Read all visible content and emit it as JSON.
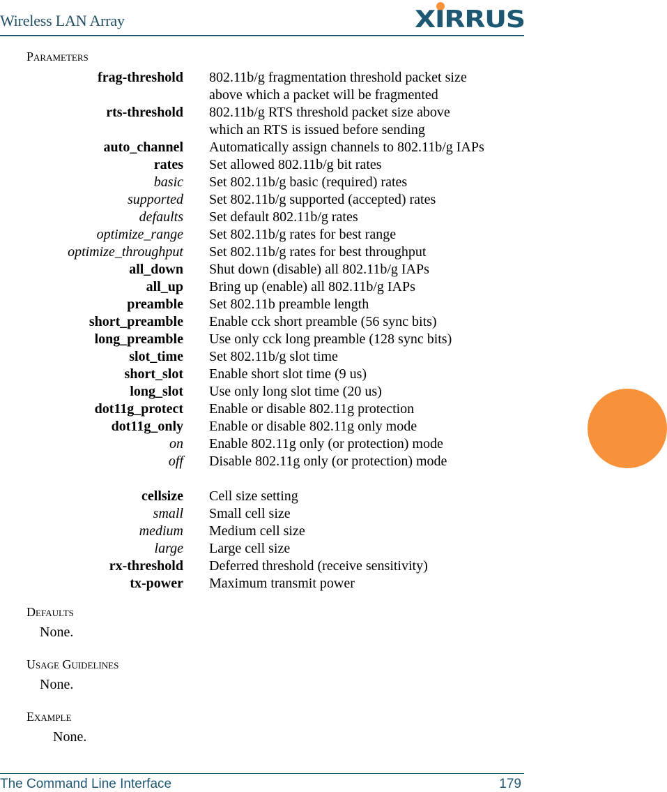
{
  "header": {
    "title": "Wireless LAN Array",
    "logo_text": "XIRRUS",
    "logo_dot_color": "#f7923a",
    "brand_color": "#1e5772"
  },
  "sections": {
    "parameters": "Parameters",
    "defaults": "Defaults",
    "defaults_body": "None.",
    "usage": "Usage Guidelines",
    "usage_body": "None.",
    "example": "Example",
    "example_body": "None."
  },
  "parameters": [
    {
      "name": "frag-threshold",
      "style": "bold",
      "desc": "802.11b/g fragmentation threshold packet size\nabove which a packet will be fragmented"
    },
    {
      "name": "rts-threshold",
      "style": "bold",
      "desc": "802.11b/g RTS threshold packet size above\nwhich an RTS is issued before sending"
    },
    {
      "name": "auto_channel",
      "style": "bold",
      "desc": "Automatically assign channels to 802.11b/g IAPs"
    },
    {
      "name": "rates",
      "style": "bold",
      "desc": "Set allowed 802.11b/g bit rates"
    },
    {
      "name": "basic",
      "style": "italic",
      "desc": "Set 802.11b/g basic (required) rates"
    },
    {
      "name": "supported",
      "style": "italic",
      "desc": "Set 802.11b/g supported (accepted) rates"
    },
    {
      "name": "defaults",
      "style": "italic",
      "desc": "Set default 802.11b/g rates"
    },
    {
      "name": "optimize_range",
      "style": "italic",
      "desc": "Set 802.11b/g rates for best range"
    },
    {
      "name": "optimize_throughput",
      "style": "italic",
      "desc": "Set 802.11b/g rates for best throughput"
    },
    {
      "name": "all_down",
      "style": "bold",
      "desc": "Shut down (disable) all 802.11b/g IAPs"
    },
    {
      "name": "all_up",
      "style": "bold",
      "desc": "Bring up (enable) all 802.11b/g IAPs"
    },
    {
      "name": "preamble",
      "style": "bold",
      "desc": "Set 802.11b preamble length"
    },
    {
      "name": "short_preamble",
      "style": "bold",
      "desc": "Enable cck short preamble (56 sync bits)"
    },
    {
      "name": "long_preamble",
      "style": "bold",
      "desc": "Use only cck long preamble (128 sync bits)"
    },
    {
      "name": "slot_time",
      "style": "bold",
      "desc": "Set 802.11b/g slot time"
    },
    {
      "name": "short_slot",
      "style": "bold",
      "desc": "Enable short slot time (9 us)"
    },
    {
      "name": "long_slot",
      "style": "bold",
      "desc": "Use only long slot time (20 us)"
    },
    {
      "name": "dot11g_protect",
      "style": "bold",
      "desc": "Enable or disable 802.11g protection"
    },
    {
      "name": "dot11g_only",
      "style": "bold",
      "desc": "Enable or disable 802.11g only mode"
    },
    {
      "name": "on",
      "style": "italic",
      "desc": "Enable 802.11g only (or protection) mode"
    },
    {
      "name": "off",
      "style": "italic",
      "desc": "Disable 802.11g only (or protection) mode"
    },
    {
      "name": "",
      "style": "spacer",
      "desc": ""
    },
    {
      "name": "cellsize",
      "style": "bold",
      "desc": "Cell size setting"
    },
    {
      "name": "small",
      "style": "italic",
      "desc": "Small cell size"
    },
    {
      "name": "medium",
      "style": "italic",
      "desc": "Medium cell size"
    },
    {
      "name": "large",
      "style": "italic",
      "desc": "Large cell size"
    },
    {
      "name": "rx-threshold",
      "style": "bold",
      "desc": "Deferred threshold (receive sensitivity)"
    },
    {
      "name": "tx-power",
      "style": "bold",
      "desc": "Maximum transmit power"
    }
  ],
  "footer": {
    "chapter": "The Command Line Interface",
    "page_number": "179"
  },
  "tab_marker_color": "#f7923a"
}
